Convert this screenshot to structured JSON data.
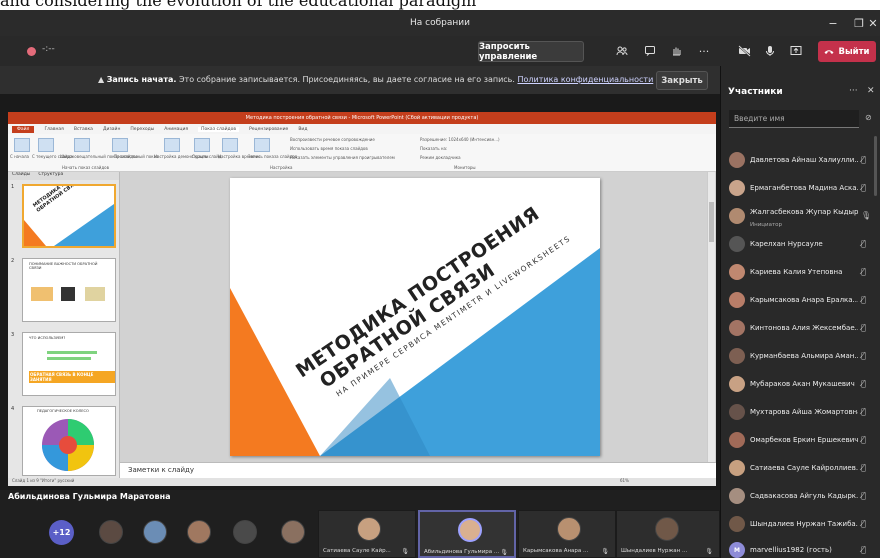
{
  "top_strip_text": "and considering the evolution of the educational paradigm",
  "window": {
    "title": "На собрании",
    "minimize": "−",
    "maximize": "❐",
    "close": "✕"
  },
  "toolbar": {
    "timer": "-:--",
    "request_control": "Запросить управление",
    "leave": "Выйти",
    "icons": [
      "people-icon",
      "chat-icon",
      "raise-hand-icon",
      "more-icon",
      "camera-off-icon",
      "mic-icon",
      "share-icon"
    ]
  },
  "recording_banner": {
    "bold": "Запись начата.",
    "message": " Это собрание записывается. Присоединяясь, вы даете согласие на его запись. ",
    "link": "Политика конфиденциальности",
    "close": "Закрыть"
  },
  "powerpoint": {
    "title": "Методика построения обратной связи - Microsoft PowerPoint (Сбой активации продукта)",
    "tabs": [
      "Файл",
      "Главная",
      "Вставка",
      "Дизайн",
      "Переходы",
      "Анимация",
      "Показ слайдов",
      "Рецензирование",
      "Вид"
    ],
    "ribbon_labels": [
      "С начала",
      "С текущего слайда",
      "Широковещательный показ слайдов",
      "Произвольный показ",
      "Настройка демонстрации",
      "Скрыть слайд",
      "Настройка времени",
      "Запись показа слайдов",
      "Воспроизвести речевое сопровождение",
      "Использовать время показа слайдов",
      "Показать элементы управления проигрывателем",
      "Разрешение: 1024x640 (Интенсивн...)",
      "Показать на:",
      "Режим докладчика"
    ],
    "ribbon_groups": [
      "Начать показ слайдов",
      "Настройка",
      "Мониторы"
    ],
    "pane_tabs": [
      "Слайды",
      "Структура"
    ],
    "thumbs": [
      {
        "num": "1",
        "text": "МЕТОДИКА ПОСТРОЕНИЯ ОБРАТНОЙ СВЯЗИ"
      },
      {
        "num": "2",
        "text": "ПОНИМАНИЕ ВАЖНОСТИ ОБРАТНОЙ СВЯЗИ"
      },
      {
        "num": "3",
        "text": "ЧТО ИСПОЛЬЗУЕМ?"
      },
      {
        "num": "4",
        "text": "ПЕДАГОГИЧЕСКОЕ КОЛЕСО"
      }
    ],
    "thumb3_highlight": "ОБРАТНАЯ СВЯЗЬ В КОНЦЕ ЗАНЯТИЯ",
    "slide_title_line1": "МЕТОДИКА ПОСТРОЕНИЯ",
    "slide_title_line2": "ОБРАТНОЙ СВЯЗИ",
    "slide_subtitle": "НА ПРИМЕРЕ СЕРВИСА MENTIMETR И LIVEWORKSHEETS",
    "notes": "Заметки к слайду",
    "status": "Слайд 1 из 9    \"Итоги\"    русский",
    "zoom": "61%",
    "colors": {
      "blue": "#3ea0db",
      "orange": "#f47a20",
      "ppt_red": "#c43e1c"
    }
  },
  "presenter": "Абильдинова Гульмира Маратовна",
  "bottom": {
    "more_count": "+12",
    "tiles": [
      {
        "name": "Сатиаева Сауле Кайр...",
        "active": false
      },
      {
        "name": "Абильдинова Гульмира ...",
        "active": true
      },
      {
        "name": "Карымсакова Анара ...",
        "active": false
      },
      {
        "name": "Шындалиев Нуржан ...",
        "active": false
      }
    ]
  },
  "participants_panel": {
    "title": "Участники",
    "more": "···",
    "close": "✕",
    "search_placeholder": "Введите имя",
    "people": [
      {
        "name": "Давлетова Айнаш Халиулли...",
        "sub": ""
      },
      {
        "name": "Ермаганбетова Мадина Аска...",
        "sub": ""
      },
      {
        "name": "Жалгасбекова Жупар Кыдыр...",
        "sub": "Инициатор"
      },
      {
        "name": "Карелхан Нурсауле",
        "sub": ""
      },
      {
        "name": "Кариева Калия Утеповна",
        "sub": ""
      },
      {
        "name": "Карымсакова Анара Ералка...",
        "sub": ""
      },
      {
        "name": "Кинтонова Алия Жексембае...",
        "sub": ""
      },
      {
        "name": "Курманбаева Альмира Аман...",
        "sub": ""
      },
      {
        "name": "Мубараков Акан Мукашевич",
        "sub": ""
      },
      {
        "name": "Мухтарова Айша Жомартовна",
        "sub": ""
      },
      {
        "name": "Омарбеков Еркин Ершекевич",
        "sub": ""
      },
      {
        "name": "Сатиаева Сауле Кайроллиев...",
        "sub": ""
      },
      {
        "name": "Садвакасова Айгуль Кадырк...",
        "sub": ""
      },
      {
        "name": "Шындалиев Нуржан Тажиба...",
        "sub": ""
      },
      {
        "name": "marvellius1982 (гость)",
        "sub": "",
        "initials": "M"
      }
    ]
  }
}
